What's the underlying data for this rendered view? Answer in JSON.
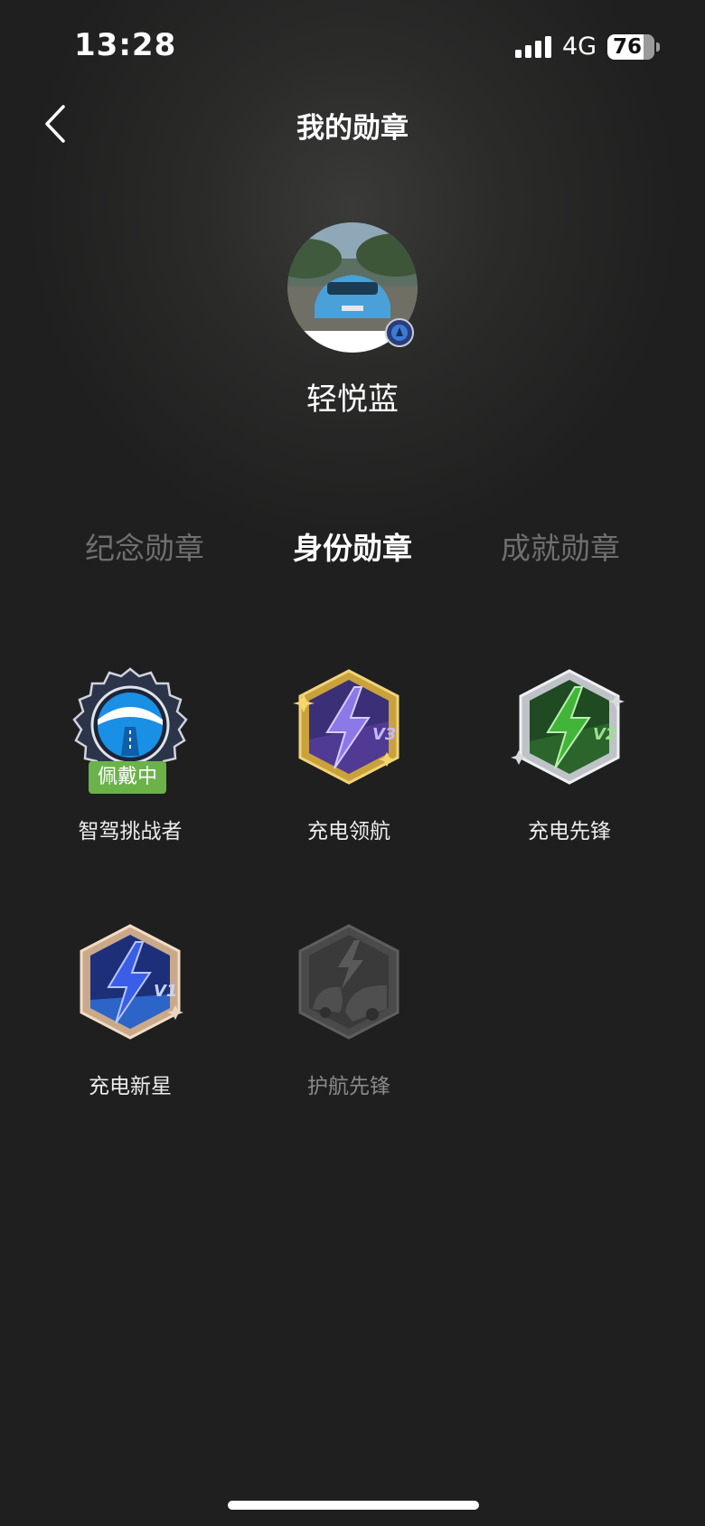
{
  "status_bar": {
    "time": "13:28",
    "network": "4G",
    "battery": "76",
    "battery_level": 0.76
  },
  "header": {
    "title": "我的勋章",
    "back_icon": "chevron-left-icon"
  },
  "profile": {
    "username": "轻悦蓝",
    "avatar_icon": "car-photo-avatar",
    "badge_icon": "identity-badge-icon"
  },
  "tabs": [
    {
      "label": "纪念勋章",
      "active": false
    },
    {
      "label": "身份勋章",
      "active": true
    },
    {
      "label": "成就勋章",
      "active": false
    }
  ],
  "badges": [
    {
      "name": "智驾挑战者",
      "icon": "steering-wheel-badge-icon",
      "wearing_label": "佩戴中",
      "locked": false
    },
    {
      "name": "充电领航",
      "icon": "lightning-v3-badge-icon",
      "locked": false
    },
    {
      "name": "充电先锋",
      "icon": "lightning-v2-badge-icon",
      "locked": false
    },
    {
      "name": "充电新星",
      "icon": "lightning-v1-badge-icon",
      "locked": false
    },
    {
      "name": "护航先锋",
      "icon": "escort-badge-icon",
      "locked": true
    }
  ],
  "colors": {
    "background": "#1f1f1f",
    "wearing_tag": "#6cb24a",
    "inactive_tab": "#6f6f6f"
  }
}
